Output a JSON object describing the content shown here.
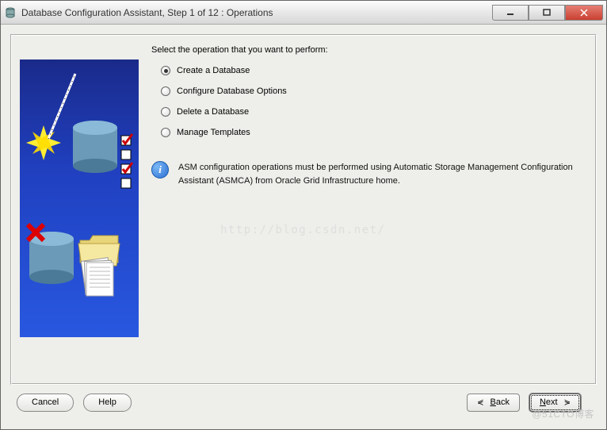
{
  "window": {
    "title": "Database Configuration Assistant, Step 1 of 12 : Operations"
  },
  "prompt": "Select the operation that you want to perform:",
  "options": [
    {
      "label": "Create a Database",
      "selected": true
    },
    {
      "label": "Configure Database Options",
      "selected": false
    },
    {
      "label": "Delete a Database",
      "selected": false
    },
    {
      "label": "Manage Templates",
      "selected": false
    }
  ],
  "info": {
    "text": "ASM configuration operations must be performed using Automatic Storage Management Configuration Assistant (ASMCA) from Oracle Grid Infrastructure home."
  },
  "buttons": {
    "cancel": "Cancel",
    "help": "Help",
    "back_arrow": "⋞",
    "back_mnemonic": "B",
    "back_rest": "ack",
    "next_mnemonic": "N",
    "next_rest": "ext",
    "next_arrow": "⋟"
  },
  "watermark": "@51CTO博客",
  "url_watermark": "http://blog.csdn.net/"
}
